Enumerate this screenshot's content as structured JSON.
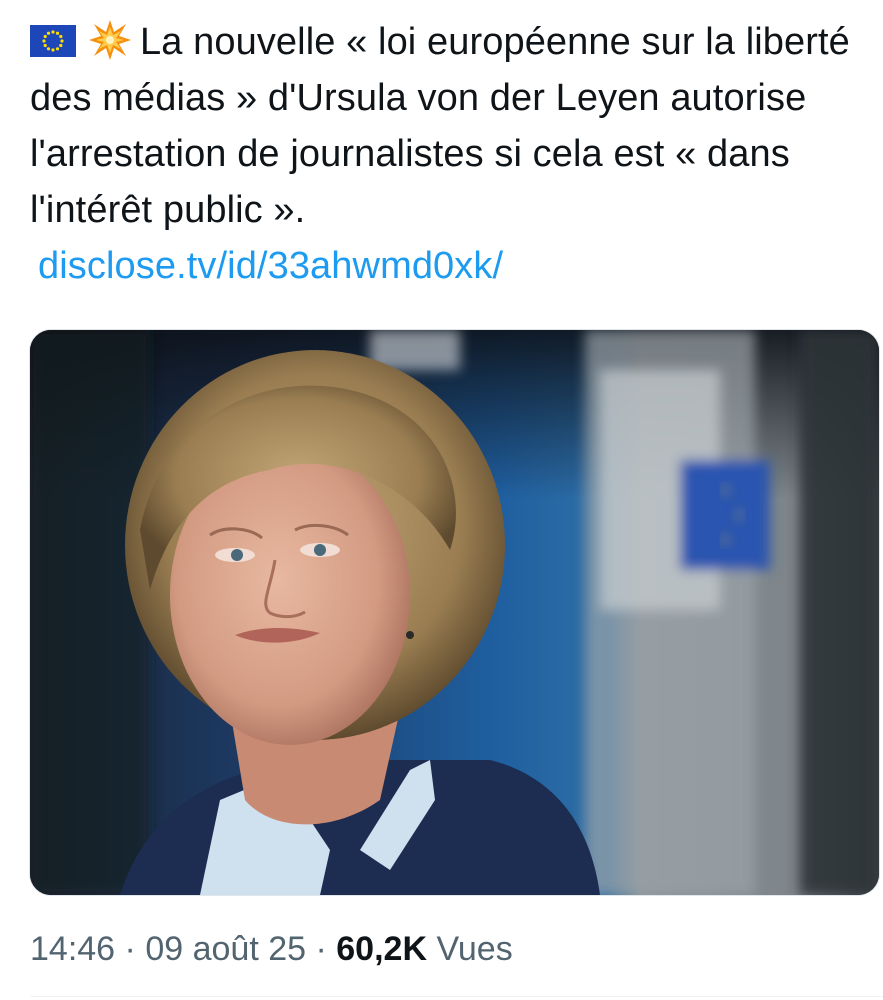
{
  "tweet": {
    "emojis": [
      "eu-flag-icon",
      "collision-icon"
    ],
    "text": "La nouvelle « loi européenne sur la liberté des médias » d'Ursula von der Leyen autorise l'arrestation de journalistes si cela est « dans l'intérêt public ».",
    "link": "disclose.tv/id/33ahwmd0xk/",
    "media": {
      "description": "photo-portrait-with-eu-flag-background"
    }
  },
  "meta": {
    "time": "14:46",
    "separator": "·",
    "date": "09 août 25",
    "views_count": "60,2K",
    "views_label": "Vues"
  },
  "colors": {
    "text": "#0f1419",
    "link": "#1d9bf0",
    "secondary": "#536471",
    "eu_blue": "#1d46b8"
  }
}
